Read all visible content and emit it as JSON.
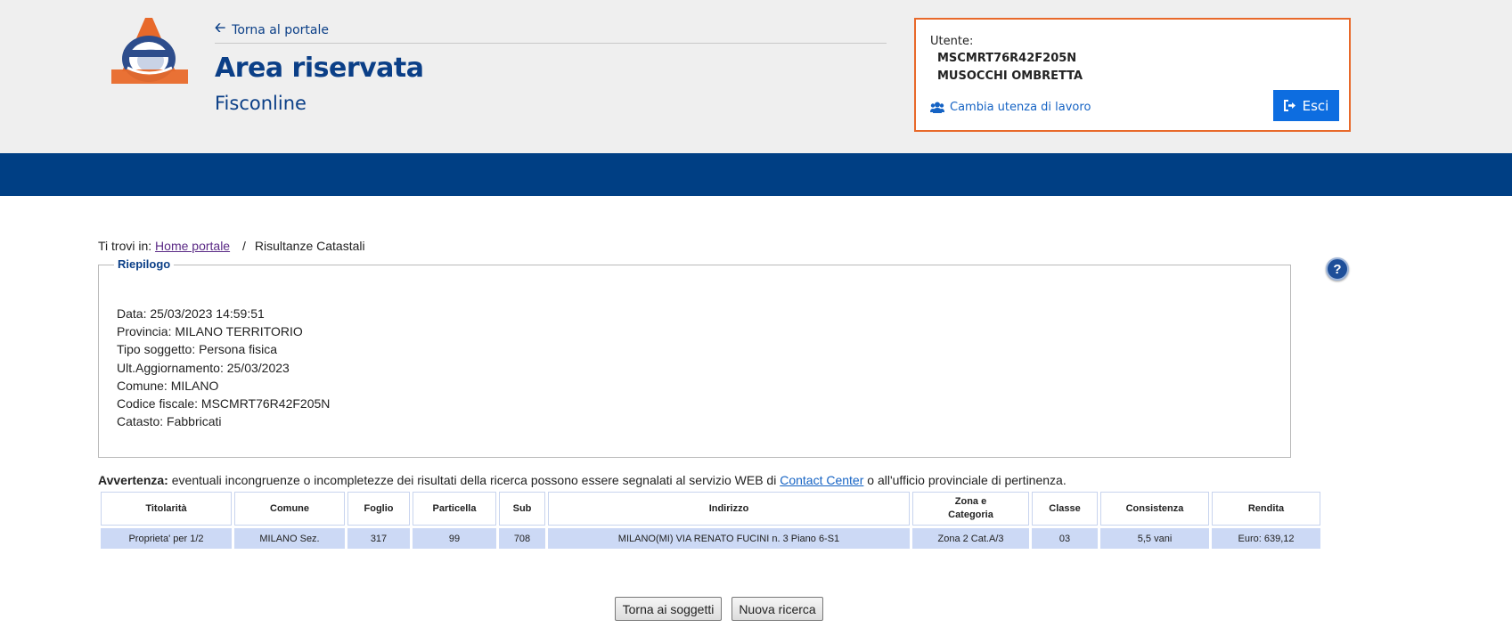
{
  "header": {
    "back_link": "Torna al portale",
    "title": "Area riservata",
    "subtitle": "Fisconline"
  },
  "user": {
    "label": "Utente:",
    "codice_fiscale": "MSCMRT76R42F205N",
    "name": "MUSOCCHI OMBRETTA",
    "change_link": "Cambia utenza di lavoro",
    "logout": "Esci"
  },
  "breadcrumb": {
    "prefix": "Ti trovi in:",
    "home": "Home portale",
    "separator": "/",
    "current": "Risultanze Catastali"
  },
  "summary": {
    "legend": "Riepilogo",
    "lines": [
      "Data: 25/03/2023 14:59:51",
      "Provincia: MILANO TERRITORIO",
      "Tipo soggetto: Persona fisica",
      "Ult.Aggiornamento: 25/03/2023",
      "Comune: MILANO",
      "Codice fiscale: MSCMRT76R42F205N",
      "Catasto: Fabbricati"
    ]
  },
  "warning": {
    "label": "Avvertenza:",
    "text_before": " eventuali incongruenze o incompletezze dei risultati della ricerca possono essere segnalati al servizio WEB di ",
    "link": "Contact Center",
    "text_after": " o all'ufficio provinciale di pertinenza."
  },
  "table": {
    "headers": [
      "Titolarità",
      "Comune",
      "Foglio",
      "Particella",
      "Sub",
      "Indirizzo",
      "Zona e",
      "Categoria",
      "Classe",
      "Consistenza",
      "Rendita"
    ],
    "rows": [
      [
        "Proprieta' per 1/2",
        "MILANO Sez.",
        "317",
        "99",
        "708",
        "MILANO(MI) VIA RENATO FUCINI n. 3 Piano 6-S1",
        "Zona 2 Cat.A/3",
        "03",
        "5,5 vani",
        "Euro: 639,12"
      ]
    ]
  },
  "buttons": {
    "back": "Torna ai soggetti",
    "new_search": "Nuova ricerca"
  },
  "help_icon": "?",
  "colors": {
    "brand_blue": "#003f84",
    "accent_orange": "#e8692a",
    "button_blue": "#0d6de0",
    "row_blue": "#ccd9f5"
  }
}
